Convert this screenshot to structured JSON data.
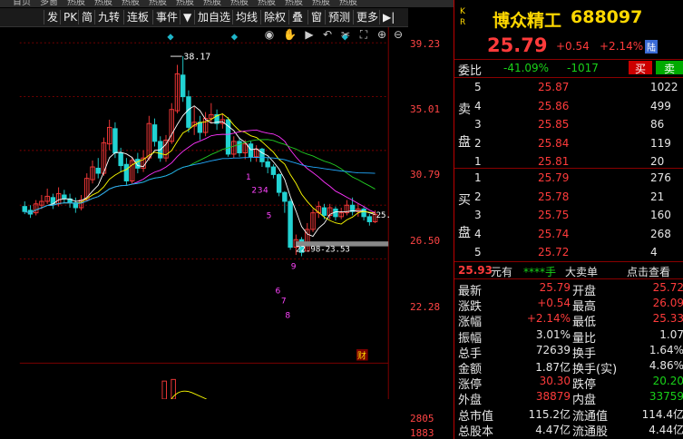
{
  "menu": {
    "items": [
      "首页",
      "多窗",
      "热股",
      "热股",
      "热股",
      "热股",
      "热股",
      "热股",
      "热股",
      "热股",
      "热股",
      "热股",
      "热股"
    ]
  },
  "toolbar": {
    "buttons": [
      "发",
      "PK",
      "简",
      "九转",
      "连板",
      "事件",
      "加自选",
      "均线",
      "除权",
      "叠",
      "窗",
      "预测",
      "更多"
    ],
    "dropdown_icon": "triangle-down-icon",
    "skip_icon": "skip-icon"
  },
  "chart": {
    "y_ticks": [
      "39.23",
      "35.01",
      "30.79",
      "26.50",
      "22.28"
    ],
    "high_label": "38.17",
    "low_label": "22.98-23.53",
    "price_right_label": "25.",
    "wave_labels": [
      "1",
      "2",
      "3",
      "4",
      "5",
      "6",
      "7",
      "8",
      "9"
    ],
    "event_tag": "财",
    "vol_ticks": [
      "2805",
      "1883"
    ],
    "icons": [
      "eye-icon",
      "hand-icon",
      "play-icon",
      "undo-icon",
      "scissors-icon",
      "fullscreen-icon",
      "zoom-in-icon",
      "zoom-out-icon"
    ]
  },
  "quote": {
    "badge_top": "K",
    "badge_bottom": "R",
    "name": "博众精工",
    "code": "688097",
    "price": "25.79",
    "change": "+0.54",
    "change_pct": "+2.14%",
    "board": "陆",
    "weibi_label": "委比",
    "weibi": "-41.09%",
    "weicha": "-1017",
    "buy_btn": "买",
    "sell_btn": "卖",
    "sell_side_label": [
      "卖",
      "盘"
    ],
    "buy_side_label": [
      "买",
      "盘"
    ],
    "asks": [
      {
        "lvl": "5",
        "price": "25.87",
        "vol": "1022"
      },
      {
        "lvl": "4",
        "price": "25.86",
        "vol": "499"
      },
      {
        "lvl": "3",
        "price": "25.85",
        "vol": "86"
      },
      {
        "lvl": "2",
        "price": "25.84",
        "vol": "119"
      },
      {
        "lvl": "1",
        "price": "25.81",
        "vol": "20"
      }
    ],
    "bids": [
      {
        "lvl": "1",
        "price": "25.79",
        "vol": "276"
      },
      {
        "lvl": "2",
        "price": "25.78",
        "vol": "21"
      },
      {
        "lvl": "3",
        "price": "25.75",
        "vol": "160"
      },
      {
        "lvl": "4",
        "price": "25.74",
        "vol": "268"
      },
      {
        "lvl": "5",
        "price": "25.72",
        "vol": "4"
      }
    ],
    "bigorder": {
      "price": "25.93",
      "unit": "元有",
      "qty": "****手",
      "label": "大卖单",
      "link": "点击查看"
    },
    "stats_left": [
      {
        "k": "最新",
        "v": "25.79"
      },
      {
        "k": "涨跌",
        "v": "+0.54"
      },
      {
        "k": "涨幅",
        "v": "+2.14%"
      },
      {
        "k": "振幅",
        "v": "3.01%"
      },
      {
        "k": "总手",
        "v": "72639"
      },
      {
        "k": "金额",
        "v": "1.87亿"
      },
      {
        "k": "涨停",
        "v": "30.30"
      },
      {
        "k": "外盘",
        "v": "38879"
      },
      {
        "k": "总市值",
        "v": "115.2亿"
      },
      {
        "k": "总股本",
        "v": "4.47亿"
      }
    ],
    "stats_right": [
      {
        "k": "开盘",
        "v": "25.72"
      },
      {
        "k": "最高",
        "v": "26.09"
      },
      {
        "k": "最低",
        "v": "25.33"
      },
      {
        "k": "量比",
        "v": "1.07"
      },
      {
        "k": "换手",
        "v": "1.64%"
      },
      {
        "k": "换手(实)",
        "v": "4.86%"
      },
      {
        "k": "跌停",
        "v": "20.20"
      },
      {
        "k": "内盘",
        "v": "33759"
      },
      {
        "k": "流通值",
        "v": "114.4亿"
      },
      {
        "k": "流通股",
        "v": "4.44亿"
      }
    ]
  }
}
